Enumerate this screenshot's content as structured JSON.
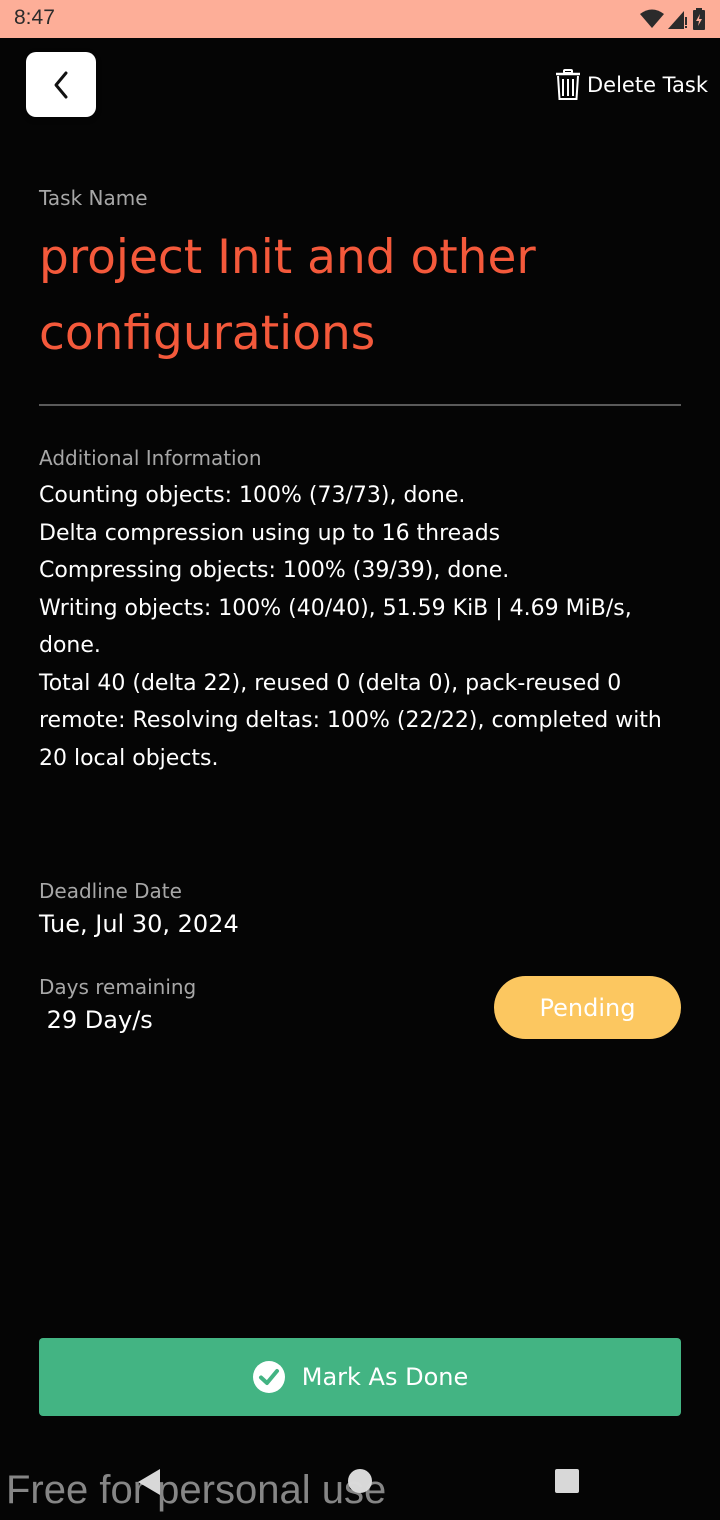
{
  "status_bar": {
    "time": "8:47"
  },
  "header": {
    "delete_label": "Delete Task"
  },
  "task": {
    "name_label": "Task Name",
    "name": "project Init and other configurations"
  },
  "info": {
    "label": "Additional Information",
    "lines": [
      "Counting objects: 100% (73/73), done.",
      "Delta compression using up to 16 threads",
      "Compressing objects: 100% (39/39), done.",
      "Writing objects: 100% (40/40), 51.59 KiB | 4.69 MiB/s, done.",
      "Total 40 (delta 22), reused 0 (delta 0), pack-reused 0",
      "remote: Resolving deltas: 100% (22/22), completed with 20 local objects."
    ]
  },
  "deadline": {
    "label": "Deadline Date",
    "value": "Tue, Jul 30, 2024"
  },
  "remaining": {
    "label": "Days remaining",
    "value": " 29 Day/s"
  },
  "status": {
    "label": "Pending",
    "color": "#fcc760"
  },
  "actions": {
    "mark_done_label": "Mark As Done",
    "color": "#43b483"
  },
  "accent_color": "#f4593b",
  "watermark": "Free for personal use"
}
